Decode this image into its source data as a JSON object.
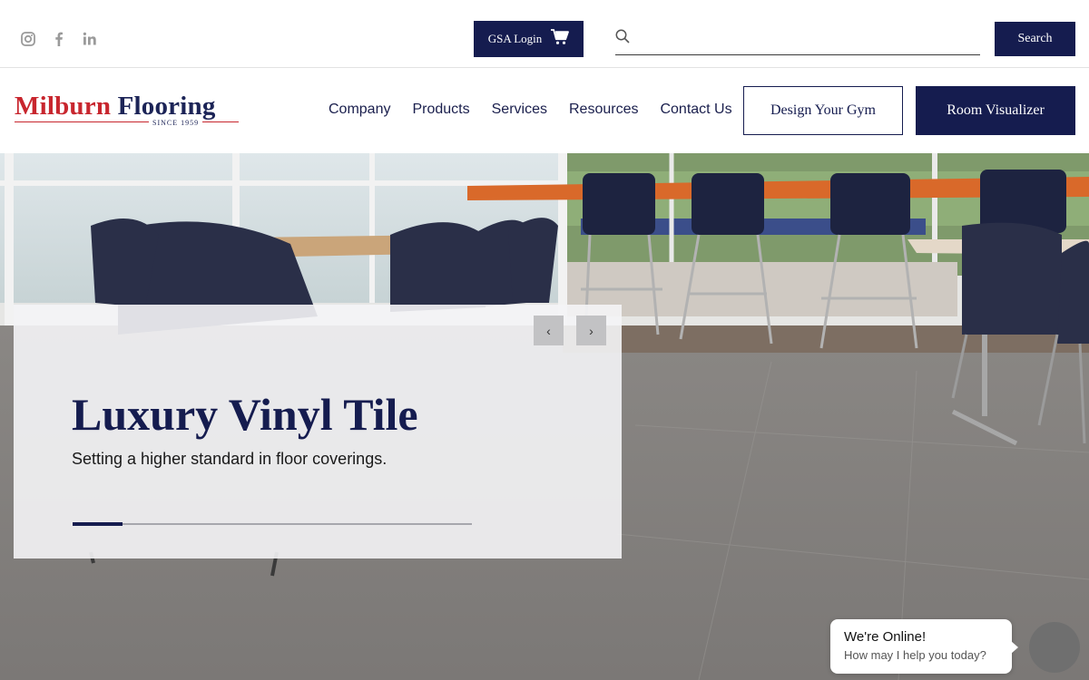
{
  "topbar": {
    "social": [
      {
        "icon": "instagram-icon"
      },
      {
        "icon": "facebook-icon"
      },
      {
        "icon": "linkedin-icon"
      }
    ],
    "gsa_login_label": "GSA Login",
    "search": {
      "value": "",
      "placeholder": ""
    },
    "search_button_label": "Search"
  },
  "header": {
    "logo": {
      "word1": "Milburn",
      "word2": "Flooring",
      "since": "SINCE 1959"
    },
    "nav": [
      "Company",
      "Products",
      "Services",
      "Resources",
      "Contact Us"
    ],
    "design_button_label": "Design Your Gym",
    "visualizer_button_label": "Room Visualizer"
  },
  "hero": {
    "title": "Luxury Vinyl Tile",
    "subtitle": "Setting a higher standard in floor coverings.",
    "prev_label": "‹",
    "next_label": "›",
    "slide_progress": 0.125
  },
  "chat": {
    "title": "We're Online!",
    "subtitle": "How may I help you today?"
  },
  "colors": {
    "navy": "#151c4f",
    "brand_red": "#c8262e",
    "icon_gray": "#9a9a9a"
  }
}
